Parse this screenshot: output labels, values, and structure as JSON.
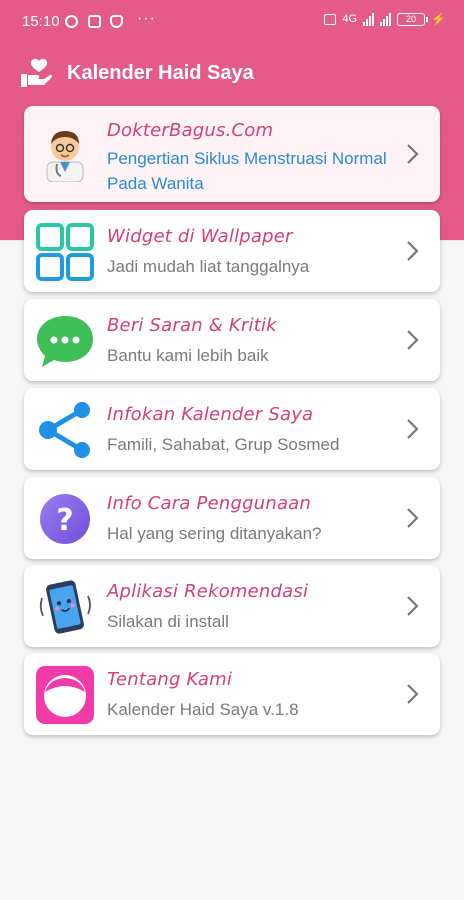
{
  "status": {
    "time": "15:10",
    "more": "···",
    "network": "4G",
    "battery": "20"
  },
  "appbar": {
    "title": "Kalender Haid Saya"
  },
  "colors": {
    "accent": "#e45b89",
    "title_pink": "#d4407a",
    "link_blue": "#2a8bd0"
  },
  "items": [
    {
      "title": "DokterBagus.Com",
      "subtitle": "Pengertian Siklus Menstruasi Normal Pada Wanita",
      "icon": "doctor-icon"
    },
    {
      "title": "Widget di Wallpaper",
      "subtitle": "Jadi mudah liat tanggalnya",
      "icon": "widget-grid-icon"
    },
    {
      "title": "Beri Saran & Kritik",
      "subtitle": "Bantu kami lebih baik",
      "icon": "chat-bubble-icon"
    },
    {
      "title": "Infokan Kalender Saya",
      "subtitle": "Famili, Sahabat, Grup Sosmed",
      "icon": "share-icon"
    },
    {
      "title": "Info Cara Penggunaan",
      "subtitle": "Hal yang sering ditanyakan?",
      "icon": "question-icon"
    },
    {
      "title": "Aplikasi Rekomendasi",
      "subtitle": "Silakan di install",
      "icon": "phone-app-icon"
    },
    {
      "title": "Tentang Kami",
      "subtitle": "Kalender Haid Saya v.1.8",
      "icon": "app-logo-icon"
    }
  ]
}
